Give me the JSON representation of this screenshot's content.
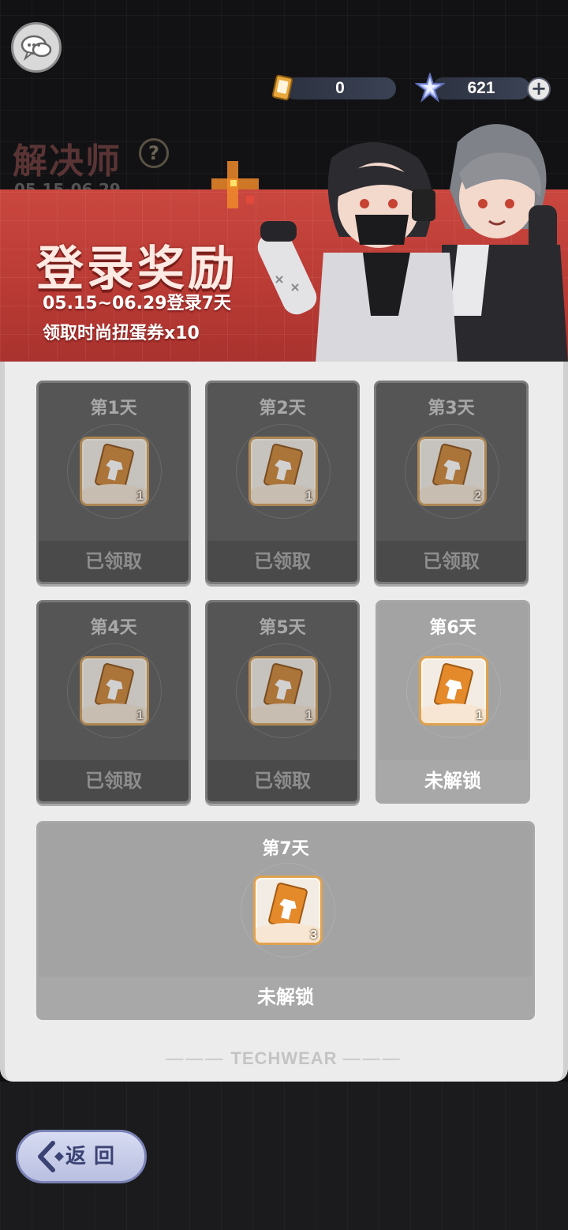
{
  "currency": {
    "ticket_count": "0",
    "star_count": "621"
  },
  "event": {
    "title": "解决师",
    "help_label": "?",
    "date_partial": "05.15-06.29"
  },
  "banner": {
    "title": "登录奖励",
    "line1": "05.15~06.29登录7天",
    "line2": "领取时尚扭蛋券x10"
  },
  "days": [
    {
      "label": "第1天",
      "count": "1",
      "status": "已领取"
    },
    {
      "label": "第2天",
      "count": "1",
      "status": "已领取"
    },
    {
      "label": "第3天",
      "count": "2",
      "status": "已领取"
    },
    {
      "label": "第4天",
      "count": "1",
      "status": "已领取"
    },
    {
      "label": "第5天",
      "count": "1",
      "status": "已领取"
    },
    {
      "label": "第6天",
      "count": "1",
      "status": "未解锁"
    },
    {
      "label": "第7天",
      "count": "3",
      "status": "未解锁"
    }
  ],
  "panel_footer": "TECHWEAR",
  "back_button": "返回",
  "colors": {
    "banner_red": "#c9473f",
    "claimed_card": "#555556",
    "locked_card": "#a3a3a3",
    "item_border": "#e0a24e"
  },
  "icons": [
    "chat-icon",
    "ticket-icon",
    "star-crystal-icon",
    "plus-icon",
    "question-icon",
    "gacha-ticket-icon",
    "back-arrow-icon"
  ]
}
